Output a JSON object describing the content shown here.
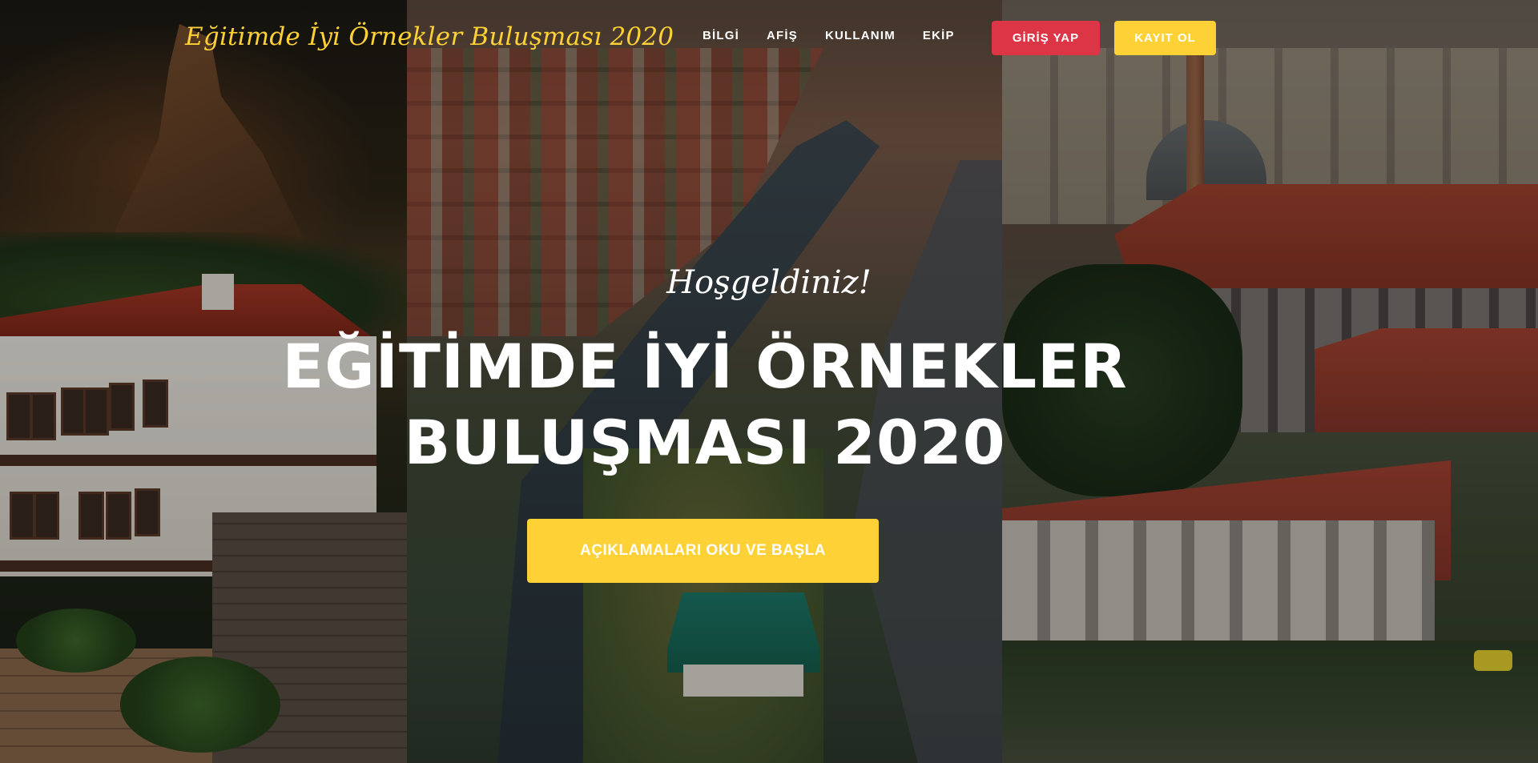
{
  "navbar": {
    "brand": "Eğitimde İyi Örnekler Buluşması 2020",
    "links": [
      {
        "label": "BİLGİ"
      },
      {
        "label": "AFİŞ"
      },
      {
        "label": "KULLANIM"
      },
      {
        "label": "EKİP"
      }
    ],
    "login_label": "GİRİŞ YAP",
    "register_label": "KAYIT OL"
  },
  "hero": {
    "welcome": "Hoşgeldiniz!",
    "headline_line1": "EĞİTİMDE İYİ ÖRNEKLER",
    "headline_line2": "BULUŞMASI 2020",
    "cta_label": "AÇIKLAMALARI OKU VE BAŞLA"
  },
  "colors": {
    "accent_yellow": "#fed136",
    "login_red": "#dc3545",
    "text_white": "#ffffff"
  }
}
